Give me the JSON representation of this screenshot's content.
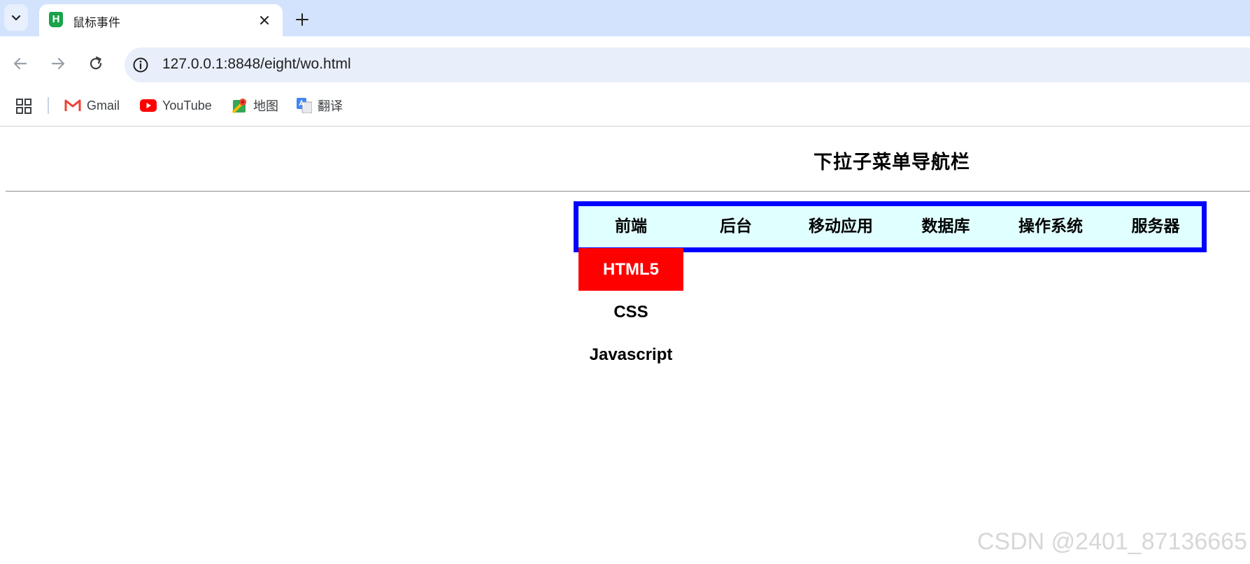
{
  "browser": {
    "tab": {
      "title": "鼠标事件",
      "favicon_letter": "H"
    },
    "omnibox": {
      "url": "127.0.0.1:8848/eight/wo.html"
    },
    "bookmarks": [
      {
        "label": "Gmail",
        "icon": "gmail-icon"
      },
      {
        "label": "YouTube",
        "icon": "youtube-icon"
      },
      {
        "label": "地图",
        "icon": "maps-icon"
      },
      {
        "label": "翻译",
        "icon": "translate-icon"
      }
    ]
  },
  "page": {
    "title": "下拉子菜单导航栏",
    "menu": [
      "前端",
      "后台",
      "移动应用",
      "数据库",
      "操作系统",
      "服务器"
    ],
    "submenu": [
      {
        "label": "HTML5",
        "active": true
      },
      {
        "label": "CSS",
        "active": false
      },
      {
        "label": "Javascript",
        "active": false
      }
    ],
    "watermark": "CSDN @2401_87136665"
  },
  "colors": {
    "menu_border": "#0000ff",
    "menu_background": "#e0ffff",
    "submenu_active": "#ff0000"
  }
}
